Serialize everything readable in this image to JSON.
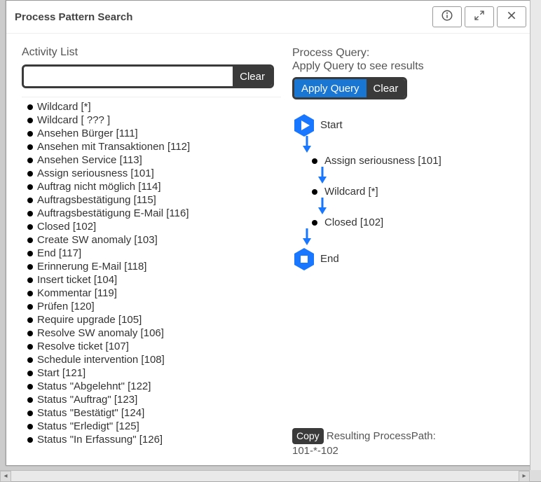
{
  "dialog": {
    "title": "Process Pattern Search"
  },
  "left": {
    "heading": "Activity List",
    "search_value": "",
    "search_placeholder": "",
    "clear_label": "Clear",
    "activities": [
      "Wildcard [*]",
      "Wildcard [ ??? ]",
      "Ansehen Bürger [111]",
      "Ansehen mit Transaktionen [112]",
      "Ansehen Service [113]",
      "Assign seriousness [101]",
      "Auftrag nicht möglich [114]",
      "Auftragsbestätigung [115]",
      "Auftragsbestätigung E-Mail [116]",
      "Closed [102]",
      "Create SW anomaly [103]",
      "End [117]",
      "Erinnerung E-Mail [118]",
      "Insert ticket [104]",
      "Kommentar [119]",
      "Prüfen [120]",
      "Require upgrade [105]",
      "Resolve SW anomaly [106]",
      "Resolve ticket [107]",
      "Schedule intervention [108]",
      "Start [121]",
      "Status \"Abgelehnt\" [122]",
      "Status \"Auftrag\" [123]",
      "Status \"Bestätigt\" [124]",
      "Status \"Erledigt\" [125]",
      "Status \"In Erfassung\" [126]"
    ]
  },
  "right": {
    "heading_line1": "Process Query:",
    "heading_line2": "Apply Query to see results",
    "apply_label": "Apply Query",
    "clear_label": "Clear",
    "start_label": "Start",
    "end_label": "End",
    "steps": [
      "Assign seriousness [101]",
      "Wildcard [*]",
      "Closed [102]"
    ],
    "copy_label": "Copy",
    "result_label": "Resulting ProcessPath:",
    "result_value": "101-*-102"
  }
}
